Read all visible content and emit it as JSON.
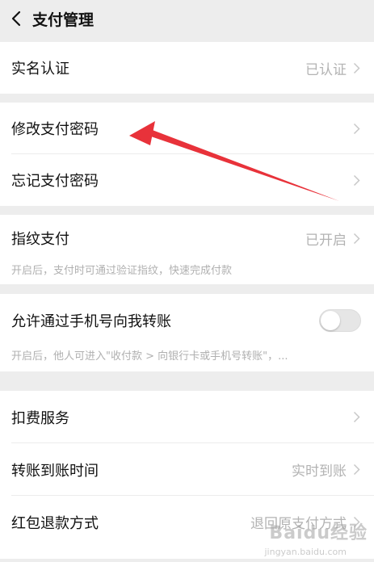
{
  "header": {
    "title": "支付管理",
    "back_icon": "chevron-left-icon"
  },
  "sections": {
    "realname": {
      "label": "实名认证",
      "value": "已认证"
    },
    "change_pwd": {
      "label": "修改支付密码"
    },
    "forget_pwd": {
      "label": "忘记支付密码"
    },
    "fingerprint": {
      "label": "指纹支付",
      "value": "已开启",
      "desc": "开启后，支付时可通过验证指纹，快速完成付款"
    },
    "phone_transfer": {
      "label": "允许通过手机号向我转账",
      "desc": "开启后，他人可进入\"收付款 > 向银行卡或手机号转账\"，...",
      "enabled": false
    },
    "deduct": {
      "label": "扣费服务"
    },
    "transfer_time": {
      "label": "转账到账时间",
      "value": "实时到账"
    },
    "redpacket": {
      "label": "红包退款方式",
      "value": "退回原支付方式"
    }
  },
  "annotation": {
    "color": "#e8323a"
  },
  "watermark": {
    "text": "Baidu经验",
    "sub": "jingyan.baidu.com"
  }
}
